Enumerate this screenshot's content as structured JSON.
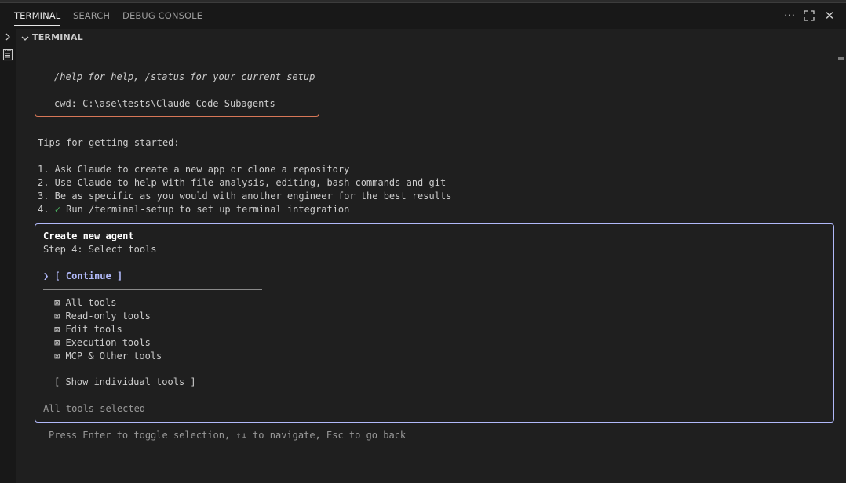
{
  "tabs": [
    {
      "label": "TERMINAL",
      "active": true
    },
    {
      "label": "SEARCH",
      "active": false
    },
    {
      "label": "DEBUG CONSOLE",
      "active": false
    }
  ],
  "actions": {
    "more": "···",
    "maximize": "⛶",
    "close": "✕"
  },
  "section": {
    "title": "TERMINAL"
  },
  "terminal": {
    "welcome": {
      "help_line": "/help for help, /status for your current setup",
      "cwd_line": "cwd: C:\\ase\\tests\\Claude Code Subagents"
    },
    "tips_title": "Tips for getting started:",
    "tips": [
      "1. Ask Claude to create a new app or clone a repository",
      "2. Use Claude to help with file analysis, editing, bash commands and git",
      "3. Be as specific as you would with another engineer for the best results"
    ],
    "tip4": {
      "prefix": "4. ",
      "check": "✓",
      "text": " Run /terminal-setup to set up terminal integration"
    },
    "agent_dialog": {
      "title": "Create new agent",
      "step": "Step 4: Select tools",
      "cursor": "❯",
      "continue_label": "[ Continue ]",
      "options": [
        "⊠ All tools",
        "⊠ Read-only tools",
        "⊠ Edit tools",
        "⊠ Execution tools",
        "⊠ MCP & Other tools"
      ],
      "show_individual": "[ Show individual tools ]",
      "status": "All tools selected"
    },
    "hint": "Press Enter to toggle selection, ↑↓ to navigate, Esc to go back"
  },
  "colors": {
    "background": "#1f1f1f",
    "welcome_border": "#d77757",
    "dialog_border": "#b1b9f9",
    "check": "#4eba65"
  }
}
